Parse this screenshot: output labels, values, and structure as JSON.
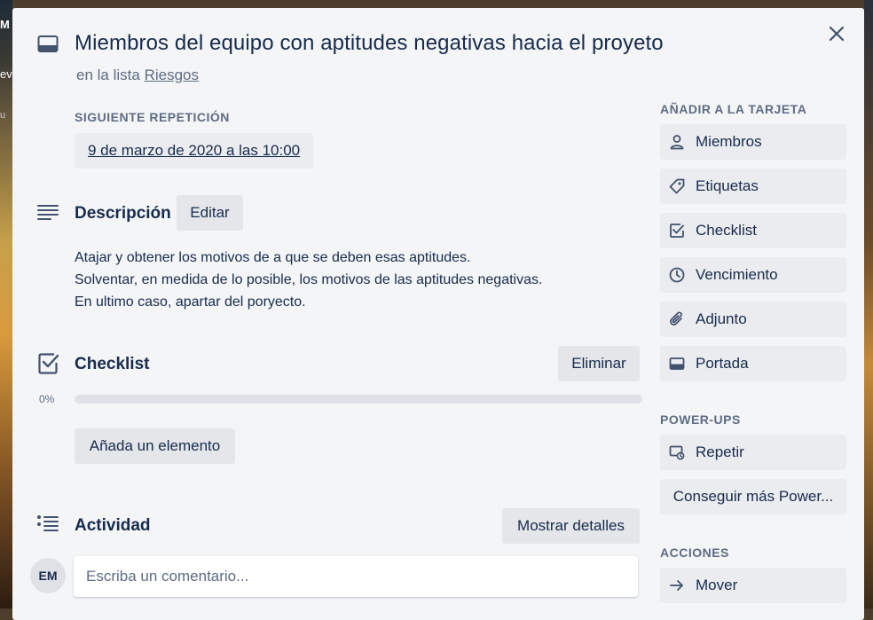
{
  "background": {
    "peek_lines": [
      "M",
      "ev",
      "u"
    ]
  },
  "card": {
    "title": "Miembros del equipo con aptitudes negativas hacia el proyeto",
    "in_list_prefix": "en la lista",
    "list_name": "Riesgos"
  },
  "repeat": {
    "label": "SIGUIENTE REPETICIÓN",
    "date": "9 de marzo de 2020 a las 10:00"
  },
  "description": {
    "title": "Descripción",
    "edit_label": "Editar",
    "lines": [
      "Atajar y obtener los motivos de a que se deben esas aptitudes.",
      "Solventar, en medida de lo posible, los motivos de las aptitudes negativas.",
      "En ultimo caso, apartar del poryecto."
    ]
  },
  "checklist": {
    "title": "Checklist",
    "delete_label": "Eliminar",
    "percent_text": "0%",
    "progress": 0,
    "add_item_label": "Añada un elemento"
  },
  "activity": {
    "title": "Actividad",
    "show_details_label": "Mostrar detalles",
    "avatar_initials": "EM",
    "comment_placeholder": "Escriba un comentario..."
  },
  "sidebar": {
    "add_heading": "AÑADIR A LA TARJETA",
    "add_items": [
      {
        "label": "Miembros",
        "icon": "person-icon"
      },
      {
        "label": "Etiquetas",
        "icon": "tag-icon"
      },
      {
        "label": "Checklist",
        "icon": "checkbox-icon"
      },
      {
        "label": "Vencimiento",
        "icon": "clock-icon"
      },
      {
        "label": "Adjunto",
        "icon": "paperclip-icon"
      },
      {
        "label": "Portada",
        "icon": "cover-icon"
      }
    ],
    "powerups_heading": "POWER-UPS",
    "powerups": [
      {
        "label": "Repetir",
        "icon": "repeat-icon"
      },
      {
        "label": "Conseguir más Power..."
      }
    ],
    "actions_heading": "ACCIONES",
    "actions": [
      {
        "label": "Mover",
        "icon": "arrow-right-icon"
      }
    ]
  },
  "colors": {
    "modal_bg": "#f4f5f7",
    "button_bg": "#ebecf0",
    "text_primary": "#172b4d",
    "text_secondary": "#5e6c84"
  }
}
